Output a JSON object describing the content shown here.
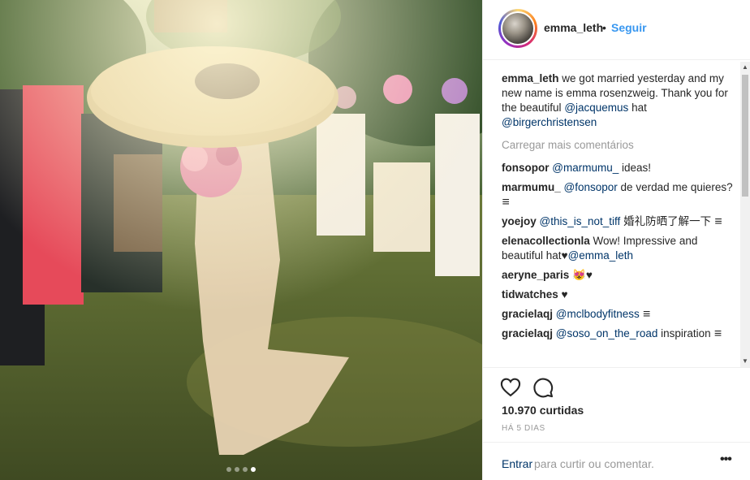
{
  "post": {
    "photo": {
      "carousel_total": 4,
      "carousel_active": 4
    },
    "header": {
      "username": "emma_leth",
      "separator": "•",
      "follow_label": "Seguir"
    },
    "caption": {
      "username": "emma_leth",
      "text_before": " we got married yesterday and my new name is emma rosenzweig. Thank you for the beautiful ",
      "mention_1": "@jacquemus",
      "text_middle": " hat ",
      "mention_2": "@birgerchristensen"
    },
    "load_more_label": "Carregar mais comentários",
    "comments": [
      {
        "username": "fonsopor",
        "parts": [
          {
            "t": " "
          },
          {
            "m": "@marmumu_"
          },
          {
            "t": " ideas!"
          }
        ]
      },
      {
        "username": "marmumu_",
        "parts": [
          {
            "t": " "
          },
          {
            "m": "@fonsopor"
          },
          {
            "t": " de verdad me quieres? 𑁔"
          }
        ]
      },
      {
        "username": "yoejoy",
        "parts": [
          {
            "t": " "
          },
          {
            "m": "@this_is_not_tiff"
          },
          {
            "t": " 婚礼防晒了解一下 𑁔"
          }
        ]
      },
      {
        "username": "elenacollectionla",
        "parts": [
          {
            "t": " Wow! Impressive and beautiful hat♥"
          },
          {
            "m": "@emma_leth"
          }
        ]
      },
      {
        "username": "aeryne_paris",
        "parts": [
          {
            "t": " 😻♥"
          }
        ]
      },
      {
        "username": "tidwatches",
        "parts": [
          {
            "t": " ♥"
          }
        ]
      },
      {
        "username": "gracielaqj",
        "parts": [
          {
            "t": " "
          },
          {
            "m": "@mclbodyfitness"
          },
          {
            "t": " 𑁔"
          }
        ]
      },
      {
        "username": "gracielaqj",
        "parts": [
          {
            "t": " "
          },
          {
            "m": "@soso_on_the_road"
          },
          {
            "t": " inspiration 𑁔"
          }
        ]
      }
    ],
    "likes_label": "10.970 curtidas",
    "time_label": "HÁ 5 DIAS",
    "login_link": "Entrar",
    "comment_prompt": "para curtir ou comentar.",
    "more_label": "•••",
    "icons": {
      "like": "heart-outline-icon",
      "comment": "comment-bubble-icon",
      "options": "more-options-icon"
    },
    "colors": {
      "link_blue": "#3897f0",
      "mention_blue": "#003569",
      "muted_gray": "#999999",
      "text": "#262626"
    }
  }
}
